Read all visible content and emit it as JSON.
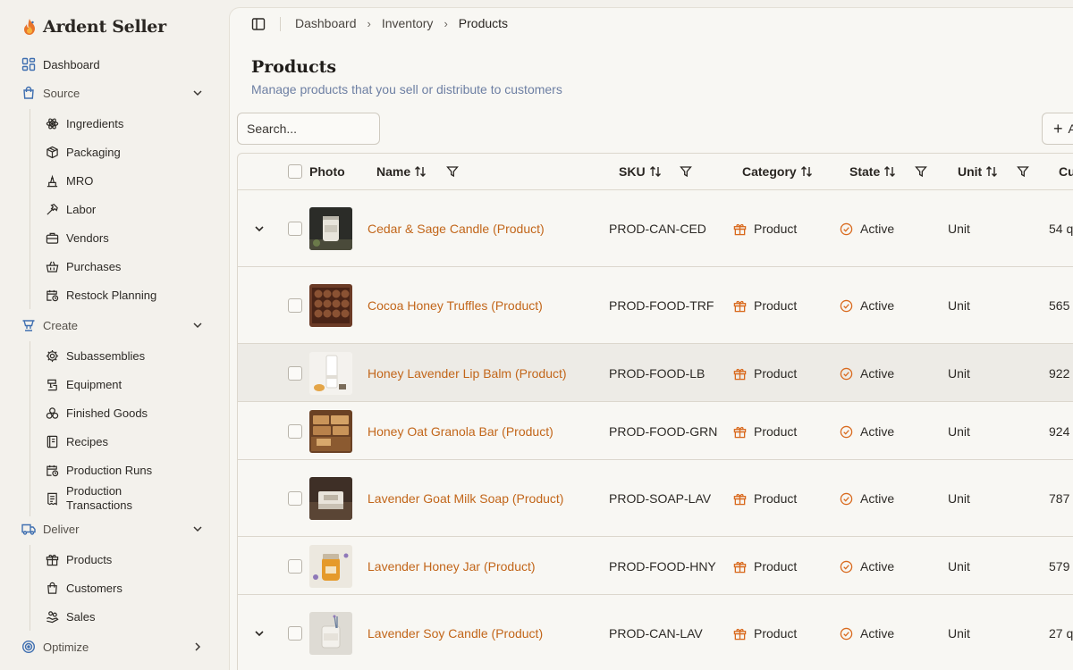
{
  "brand": {
    "name": "Ardent Seller",
    "accent": "#e8742b"
  },
  "sidebar": {
    "dashboard": {
      "label": "Dashboard",
      "icon": "dashboard-icon"
    },
    "source": {
      "label": "Source",
      "icon": "shopping-bag-icon",
      "items": [
        {
          "label": "Ingredients",
          "icon": "atom-icon"
        },
        {
          "label": "Packaging",
          "icon": "box-icon"
        },
        {
          "label": "MRO",
          "icon": "wrench-stand-icon"
        },
        {
          "label": "Labor",
          "icon": "hammer-icon"
        },
        {
          "label": "Vendors",
          "icon": "briefcase-icon"
        },
        {
          "label": "Purchases",
          "icon": "basket-icon"
        },
        {
          "label": "Restock Planning",
          "icon": "calendar-clock-icon"
        }
      ]
    },
    "create": {
      "label": "Create",
      "icon": "cooking-pot-icon",
      "items": [
        {
          "label": "Subassemblies",
          "icon": "cog-icon"
        },
        {
          "label": "Equipment",
          "icon": "mixer-icon"
        },
        {
          "label": "Finished Goods",
          "icon": "cookies-icon"
        },
        {
          "label": "Recipes",
          "icon": "book-icon"
        },
        {
          "label": "Production Runs",
          "icon": "calendar-clock-icon"
        },
        {
          "label": "Production Transactions",
          "icon": "receipt-icon"
        }
      ]
    },
    "deliver": {
      "label": "Deliver",
      "icon": "truck-icon",
      "items": [
        {
          "label": "Products",
          "icon": "gift-icon"
        },
        {
          "label": "Customers",
          "icon": "shopping-bag-icon"
        },
        {
          "label": "Sales",
          "icon": "hand-coins-icon"
        }
      ]
    },
    "optimize": {
      "label": "Optimize",
      "icon": "target-icon"
    }
  },
  "breadcrumb": [
    "Dashboard",
    "Inventory",
    "Products"
  ],
  "page": {
    "title": "Products",
    "subtitle": "Manage products that you sell or distribute to customers",
    "search_placeholder": "Search...",
    "add_label": "A"
  },
  "table": {
    "columns": {
      "photo": "Photo",
      "name": "Name",
      "sku": "SKU",
      "category": "Category",
      "state": "State",
      "unit": "Unit",
      "qty": "Cu"
    },
    "rows": [
      {
        "expandable": true,
        "name": "Cedar & Sage Candle (Product)",
        "sku": "PROD-CAN-CED",
        "category": "Product",
        "state": "Active",
        "unit": "Unit",
        "qty": "54 q",
        "photo": "candle-jar-dark",
        "highlight": false
      },
      {
        "expandable": false,
        "name": "Cocoa Honey Truffles (Product)",
        "sku": "PROD-FOOD-TRF",
        "category": "Product",
        "state": "Active",
        "unit": "Unit",
        "qty": "565",
        "photo": "truffles-box",
        "highlight": false
      },
      {
        "expandable": false,
        "name": "Honey Lavender Lip Balm (Product)",
        "sku": "PROD-FOOD-LB",
        "category": "Product",
        "state": "Active",
        "unit": "Unit",
        "qty": "922",
        "photo": "lip-balm",
        "highlight": true
      },
      {
        "expandable": false,
        "name": "Honey Oat Granola Bar (Product)",
        "sku": "PROD-FOOD-GRN",
        "category": "Product",
        "state": "Active",
        "unit": "Unit",
        "qty": "924",
        "photo": "granola-bars",
        "highlight": false
      },
      {
        "expandable": false,
        "name": "Lavender Goat Milk Soap (Product)",
        "sku": "PROD-SOAP-LAV",
        "category": "Product",
        "state": "Active",
        "unit": "Unit",
        "qty": "787",
        "photo": "soap-bar",
        "highlight": false
      },
      {
        "expandable": false,
        "name": "Lavender Honey Jar (Product)",
        "sku": "PROD-FOOD-HNY",
        "category": "Product",
        "state": "Active",
        "unit": "Unit",
        "qty": "579",
        "photo": "honey-jar",
        "highlight": false
      },
      {
        "expandable": true,
        "name": "Lavender Soy Candle (Product)",
        "sku": "PROD-CAN-LAV",
        "category": "Product",
        "state": "Active",
        "unit": "Unit",
        "qty": "27 q",
        "photo": "candle-jar-light",
        "highlight": false
      }
    ]
  },
  "colors": {
    "link": "#c2661a",
    "nav_icon": "#3f6fb0",
    "subtitle": "#6d7fa3"
  }
}
